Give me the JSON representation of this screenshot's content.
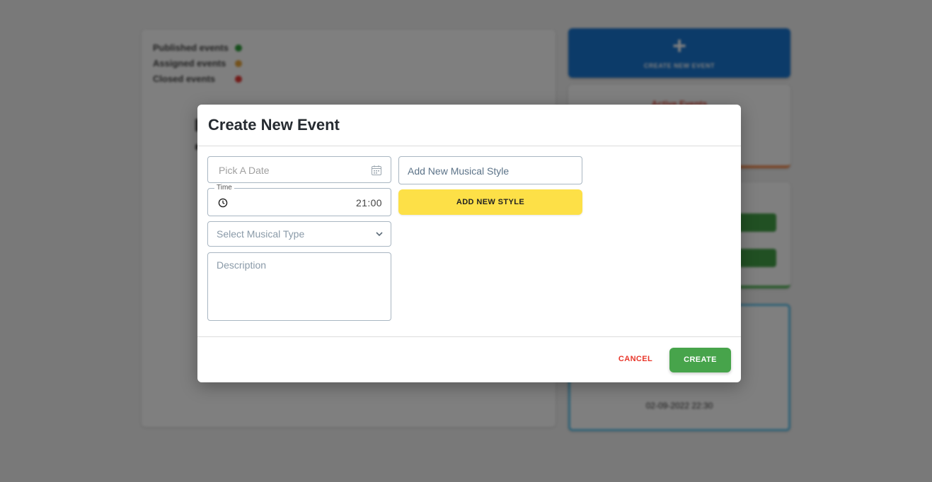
{
  "background": {
    "legend": [
      {
        "label": "Published events",
        "color": "#2e9e3a"
      },
      {
        "label": "Assigned events",
        "color": "#e8a43a"
      },
      {
        "label": "Closed events",
        "color": "#e53935"
      }
    ],
    "create_card": {
      "icon": "plus-icon",
      "label": "CREATE NEW EVENT"
    },
    "orange_card_title": "Active Events",
    "blue_card_footer": "02-09-2022 22:30"
  },
  "modal": {
    "title": "Create New Event",
    "date_field": {
      "placeholder": "Pick A Date",
      "icon": "calendar-icon"
    },
    "time_field": {
      "label": "Time",
      "value": "21:00",
      "icon": "clock-icon"
    },
    "musical_type_select": {
      "placeholder": "Select Musical Type",
      "icon": "chevron-down-icon"
    },
    "description": {
      "placeholder": "Description"
    },
    "new_style_input": {
      "placeholder": "Add New Musical Style"
    },
    "add_style_button": "ADD NEW STYLE",
    "cancel_button": "CANCEL",
    "create_button": "CREATE"
  },
  "colors": {
    "primary_blue": "#1976d2",
    "create_green": "#47a44b",
    "add_style_yellow": "#fde047",
    "cancel_red": "#e8362a"
  }
}
